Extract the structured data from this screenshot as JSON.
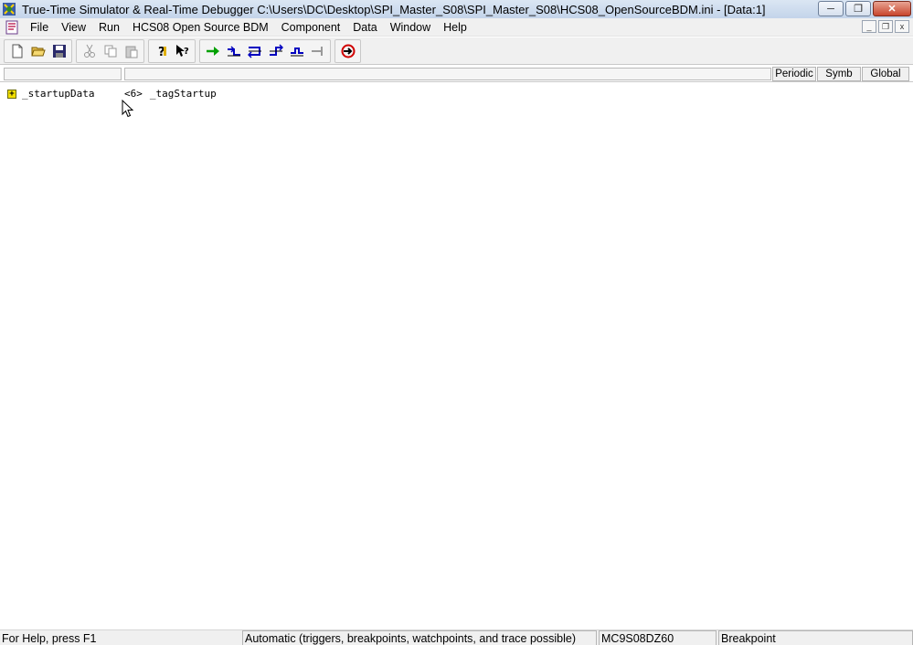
{
  "window": {
    "title": "True-Time Simulator & Real-Time Debugger   C:\\Users\\DC\\Desktop\\SPI_Master_S08\\SPI_Master_S08\\HCS08_OpenSourceBDM.ini - [Data:1]",
    "minimize": "─",
    "restore": "❐",
    "close": "✕"
  },
  "menubar": {
    "items": [
      "File",
      "View",
      "Run",
      "HCS08 Open Source BDM",
      "Component",
      "Data",
      "Window",
      "Help"
    ],
    "mdi_minimize": "_",
    "mdi_restore": "❐",
    "mdi_close": "x"
  },
  "toolbar": {
    "icons": [
      "new-file-icon",
      "open-folder-icon",
      "save-icon",
      "cut-icon",
      "copy-icon",
      "paste-icon",
      "help-icon",
      "context-help-icon",
      "run-start-icon",
      "single-step-icon",
      "step-over-icon",
      "step-out-icon",
      "assembly-step-icon",
      "halt-icon",
      "reset-icon"
    ]
  },
  "header": {
    "tabs": [
      "Periodic",
      "Symb",
      "Global"
    ]
  },
  "data_view": {
    "rows": [
      {
        "expand": "+",
        "name": "_startupData",
        "size": "<6>",
        "type": "_tagStartup"
      }
    ]
  },
  "statusbar": {
    "help": "For Help, press F1",
    "mode": "Automatic (triggers, breakpoints, watchpoints, and trace possible)",
    "device": "MC9S08DZ60",
    "state": "Breakpoint"
  },
  "colors": {
    "title_gradient_top": "#dbe6f3",
    "expand_box": "#f3e000",
    "run_green": "#00a000",
    "step_blue": "#0000c0",
    "reset_red": "#d00000"
  }
}
